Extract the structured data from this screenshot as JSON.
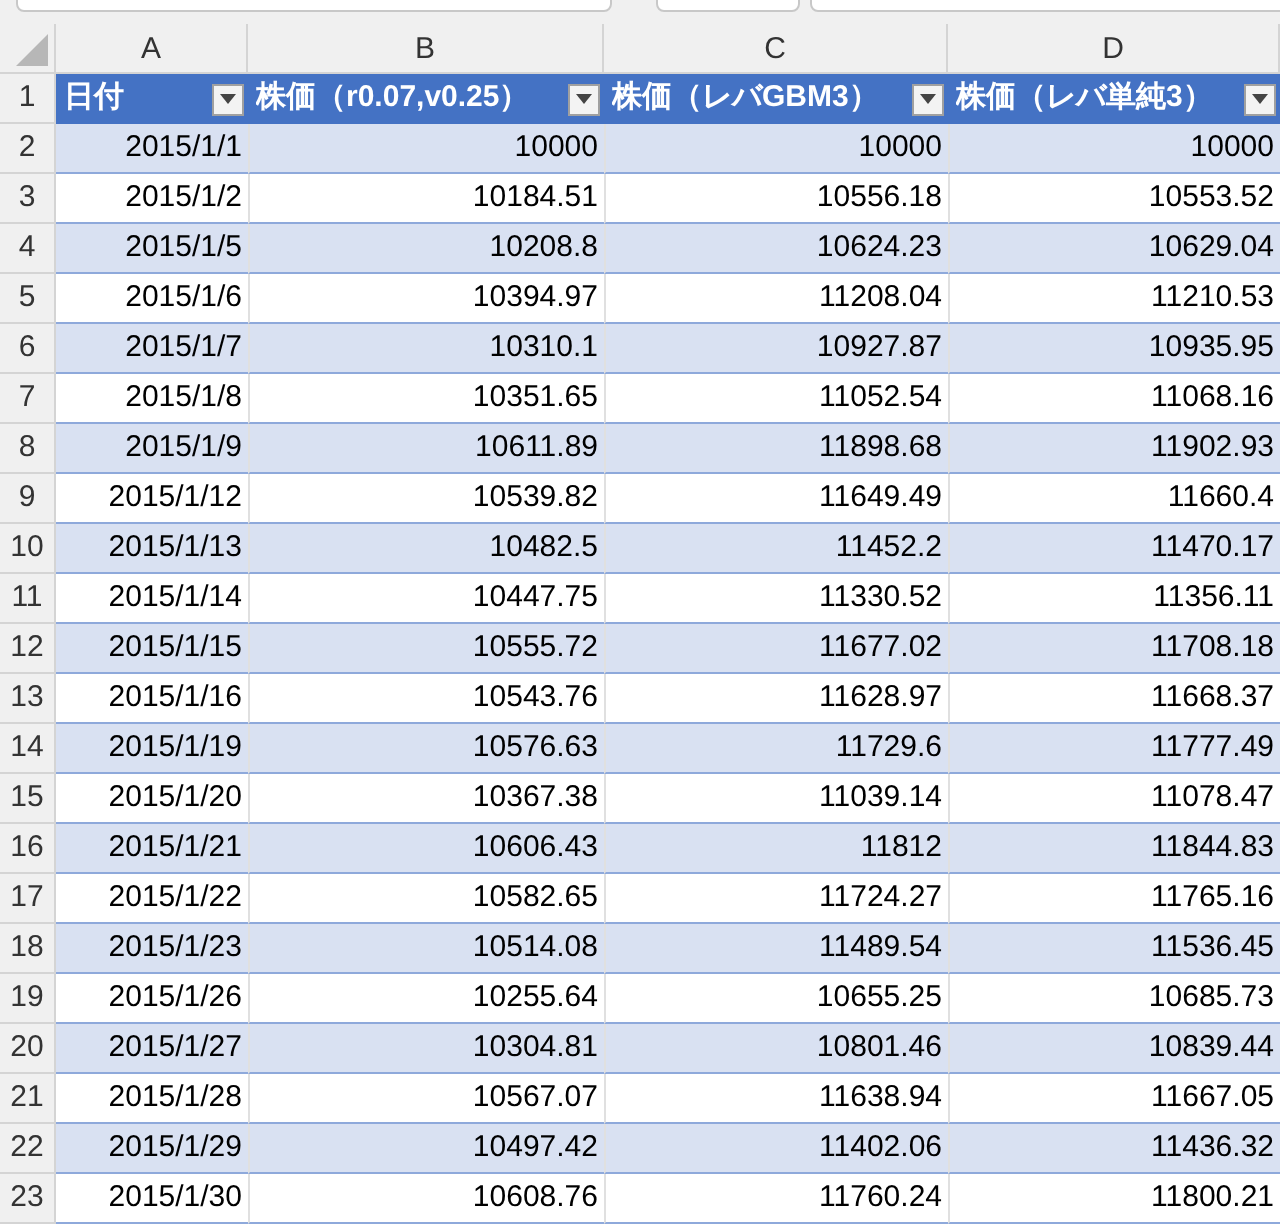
{
  "columns": [
    "A",
    "B",
    "C",
    "D"
  ],
  "header": {
    "row": "1",
    "cells": [
      "日付",
      "株価（r0.07,v0.25）",
      "株価（レバGBM3）",
      "株価（レバ単純3）"
    ]
  },
  "rows": [
    {
      "row": "2",
      "cells": [
        "2015/1/1",
        "10000",
        "10000",
        "10000"
      ]
    },
    {
      "row": "3",
      "cells": [
        "2015/1/2",
        "10184.51",
        "10556.18",
        "10553.52"
      ]
    },
    {
      "row": "4",
      "cells": [
        "2015/1/5",
        "10208.8",
        "10624.23",
        "10629.04"
      ]
    },
    {
      "row": "5",
      "cells": [
        "2015/1/6",
        "10394.97",
        "11208.04",
        "11210.53"
      ]
    },
    {
      "row": "6",
      "cells": [
        "2015/1/7",
        "10310.1",
        "10927.87",
        "10935.95"
      ]
    },
    {
      "row": "7",
      "cells": [
        "2015/1/8",
        "10351.65",
        "11052.54",
        "11068.16"
      ]
    },
    {
      "row": "8",
      "cells": [
        "2015/1/9",
        "10611.89",
        "11898.68",
        "11902.93"
      ]
    },
    {
      "row": "9",
      "cells": [
        "2015/1/12",
        "10539.82",
        "11649.49",
        "11660.4"
      ]
    },
    {
      "row": "10",
      "cells": [
        "2015/1/13",
        "10482.5",
        "11452.2",
        "11470.17"
      ]
    },
    {
      "row": "11",
      "cells": [
        "2015/1/14",
        "10447.75",
        "11330.52",
        "11356.11"
      ]
    },
    {
      "row": "12",
      "cells": [
        "2015/1/15",
        "10555.72",
        "11677.02",
        "11708.18"
      ]
    },
    {
      "row": "13",
      "cells": [
        "2015/1/16",
        "10543.76",
        "11628.97",
        "11668.37"
      ]
    },
    {
      "row": "14",
      "cells": [
        "2015/1/19",
        "10576.63",
        "11729.6",
        "11777.49"
      ]
    },
    {
      "row": "15",
      "cells": [
        "2015/1/20",
        "10367.38",
        "11039.14",
        "11078.47"
      ]
    },
    {
      "row": "16",
      "cells": [
        "2015/1/21",
        "10606.43",
        "11812",
        "11844.83"
      ]
    },
    {
      "row": "17",
      "cells": [
        "2015/1/22",
        "10582.65",
        "11724.27",
        "11765.16"
      ]
    },
    {
      "row": "18",
      "cells": [
        "2015/1/23",
        "10514.08",
        "11489.54",
        "11536.45"
      ]
    },
    {
      "row": "19",
      "cells": [
        "2015/1/26",
        "10255.64",
        "10655.25",
        "10685.73"
      ]
    },
    {
      "row": "20",
      "cells": [
        "2015/1/27",
        "10304.81",
        "10801.46",
        "10839.44"
      ]
    },
    {
      "row": "21",
      "cells": [
        "2015/1/28",
        "10567.07",
        "11638.94",
        "11667.05"
      ]
    },
    {
      "row": "22",
      "cells": [
        "2015/1/29",
        "10497.42",
        "11402.06",
        "11436.32"
      ]
    },
    {
      "row": "23",
      "cells": [
        "2015/1/30",
        "10608.76",
        "11760.24",
        "11800.21"
      ]
    }
  ]
}
